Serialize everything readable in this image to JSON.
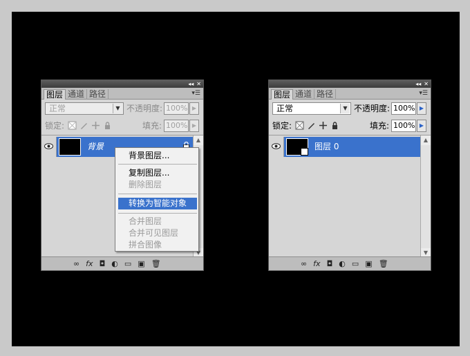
{
  "panel_left": {
    "tabs": [
      "图层",
      "通道",
      "路径"
    ],
    "blend_mode": "正常",
    "opacity_label": "不透明度:",
    "opacity_value": "100%",
    "lock_label": "锁定:",
    "fill_label": "填充:",
    "fill_value": "100%",
    "layer_name": "背景"
  },
  "panel_right": {
    "tabs": [
      "图层",
      "通道",
      "路径"
    ],
    "blend_mode": "正常",
    "opacity_label": "不透明度:",
    "opacity_value": "100%",
    "lock_label": "锁定:",
    "fill_label": "填充:",
    "fill_value": "100%",
    "layer_name": "图层 0"
  },
  "context_menu": {
    "items": [
      {
        "label": "背景图层...",
        "state": "enabled"
      },
      {
        "label": "复制图层...",
        "state": "enabled"
      },
      {
        "label": "删除图层",
        "state": "disabled"
      },
      {
        "label": "转换为智能对象",
        "state": "highlighted"
      },
      {
        "label": "合并图层",
        "state": "disabled"
      },
      {
        "label": "合并可见图层",
        "state": "disabled"
      },
      {
        "label": "拼合图像",
        "state": "disabled"
      }
    ]
  },
  "colors": {
    "selection": "#3a72cc",
    "panel_bg": "#d6d6d6",
    "stage_bg": "#000000"
  }
}
